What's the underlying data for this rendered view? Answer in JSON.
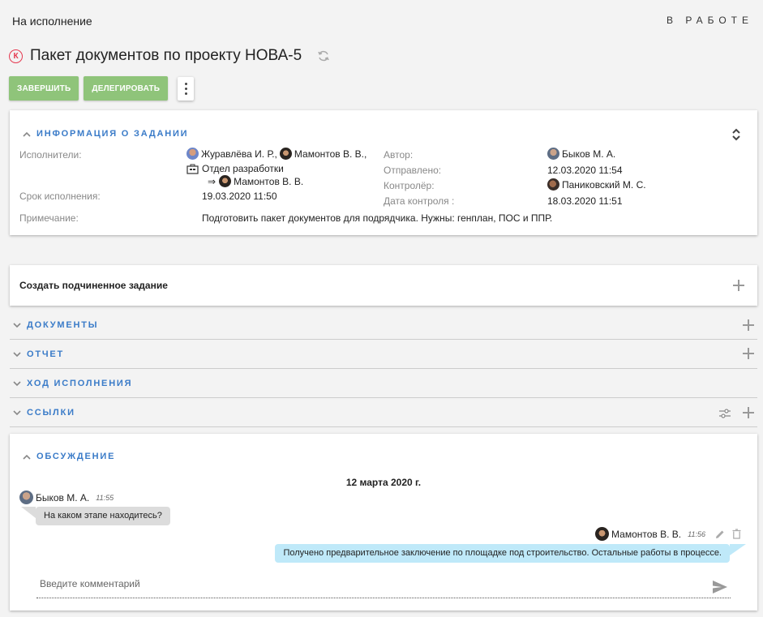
{
  "header": {
    "mode": "На исполнение",
    "status": "В РАБОТЕ"
  },
  "task": {
    "badge": "К",
    "title": "Пакет документов по проекту НОВА-5"
  },
  "actions": {
    "complete": "ЗАВЕРШИТЬ",
    "delegate": "ДЕЛЕГИРОВАТЬ"
  },
  "info": {
    "heading": "ИНФОРМАЦИЯ О ЗАДАНИИ",
    "labels": {
      "executors": "Исполнители:",
      "deadline": "Срок исполнения:",
      "note": "Примечание:",
      "author": "Автор:",
      "sent": "Отправлено:",
      "controller": "Контролёр:",
      "control_date": "Дата контроля :"
    },
    "executors": {
      "first": "Журавлёва И. Р.,",
      "second": "Мамонтов В. В.,",
      "department": "Отдел разработки",
      "delegated_arrow": "⇒",
      "delegated": "Мамонтов В. В."
    },
    "deadline": "19.03.2020 11:50",
    "note": "Подготовить пакет документов для подрядчика. Нужны: генплан, ПОС и ППР.",
    "author": "Быков М. А.",
    "sent": "12.03.2020 11:54",
    "controller": "Паниковский М. С.",
    "control_date": "18.03.2020 11:51"
  },
  "subtask": {
    "label": "Создать подчиненное задание"
  },
  "sections": {
    "documents": "ДОКУМЕНТЫ",
    "report": "ОТЧЕТ",
    "progress": "ХОД ИСПОЛНЕНИЯ",
    "links": "ССЫЛКИ"
  },
  "discussion": {
    "heading": "ОБСУЖДЕНИЕ",
    "date": "12 марта 2020 г.",
    "messages": [
      {
        "author": "Быков М. А.",
        "time": "11:55",
        "text": "На каком этапе находитесь?"
      },
      {
        "author": "Мамонтов В. В.",
        "time": "11:56",
        "text": "Получено предварительное заключение по площадке под строительство. Остальные работы в процессе."
      }
    ],
    "comment_placeholder": "Введите комментарий"
  },
  "colors": {
    "accent": "#3a7bc8",
    "button_green": "#8fc47a",
    "badge_red": "#e53950",
    "incoming_bubble": "#dcdcdc",
    "outgoing_bubble": "#bfe9f9"
  }
}
